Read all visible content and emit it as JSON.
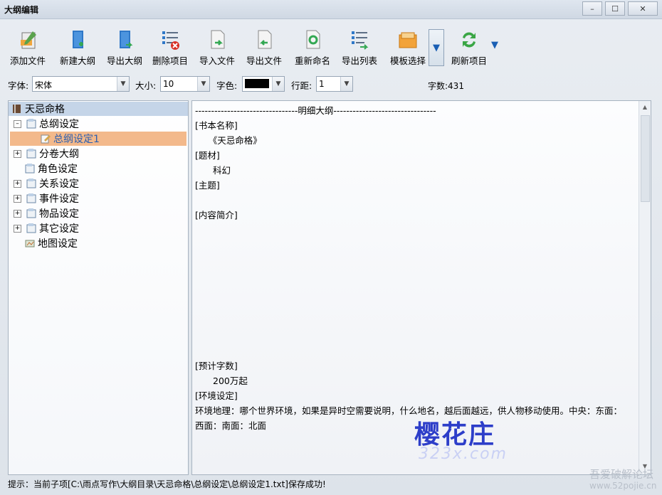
{
  "window": {
    "title": "大纲编辑",
    "minimize": "–",
    "maximize": "☐",
    "close": "✕"
  },
  "toolbar": {
    "add_file": "添加文件",
    "new_outline": "新建大纲",
    "export_outline": "导出大纲",
    "delete_item": "删除项目",
    "import_file": "导入文件",
    "export_file": "导出文件",
    "rename": "重新命名",
    "export_list": "导出列表",
    "template_select": "模板选择",
    "refresh_item": "刷新项目",
    "dropdown_glyph": "▼"
  },
  "options": {
    "font_label": "字体:",
    "font_value": "宋体",
    "size_label": "大小:",
    "size_value": "10",
    "color_label": "字色:",
    "color_value": "#000000",
    "spacing_label": "行距:",
    "spacing_value": "1",
    "word_count": "字数:431"
  },
  "tree": {
    "root": "天忌命格",
    "items": [
      {
        "label": "总纲设定",
        "expander": "–"
      },
      {
        "label": "总纲设定1"
      },
      {
        "label": "分卷大纲",
        "expander": "+"
      },
      {
        "label": "角色设定"
      },
      {
        "label": "关系设定",
        "expander": "+"
      },
      {
        "label": "事件设定",
        "expander": "+"
      },
      {
        "label": "物品设定",
        "expander": "+"
      },
      {
        "label": "其它设定",
        "expander": "+"
      },
      {
        "label": "地图设定"
      }
    ]
  },
  "editor": {
    "lines": [
      "--------------------------------明细大纲--------------------------------",
      "[书本名称]",
      "　　《天忌命格》",
      "[题材]",
      "　　科幻",
      "[主题]",
      "[内容简介]",
      "[预计字数]",
      "　　200万起",
      "[环境设定]",
      " 环境地理：哪个世界环境，如果是异时空需要说明，什么地名，越后面越远，供人物移动使用。中央：东面：",
      "西面：南面：北面"
    ]
  },
  "watermark": {
    "main": "樱花庄",
    "sub": "323x.com"
  },
  "corner": {
    "line1": "吾爱破解论坛",
    "line2": "www.52pojie.cn"
  },
  "status": "提示：当前子项[C:\\雨点写作\\大纲目录\\天忌命格\\总纲设定\\总纲设定1.txt]保存成功!"
}
